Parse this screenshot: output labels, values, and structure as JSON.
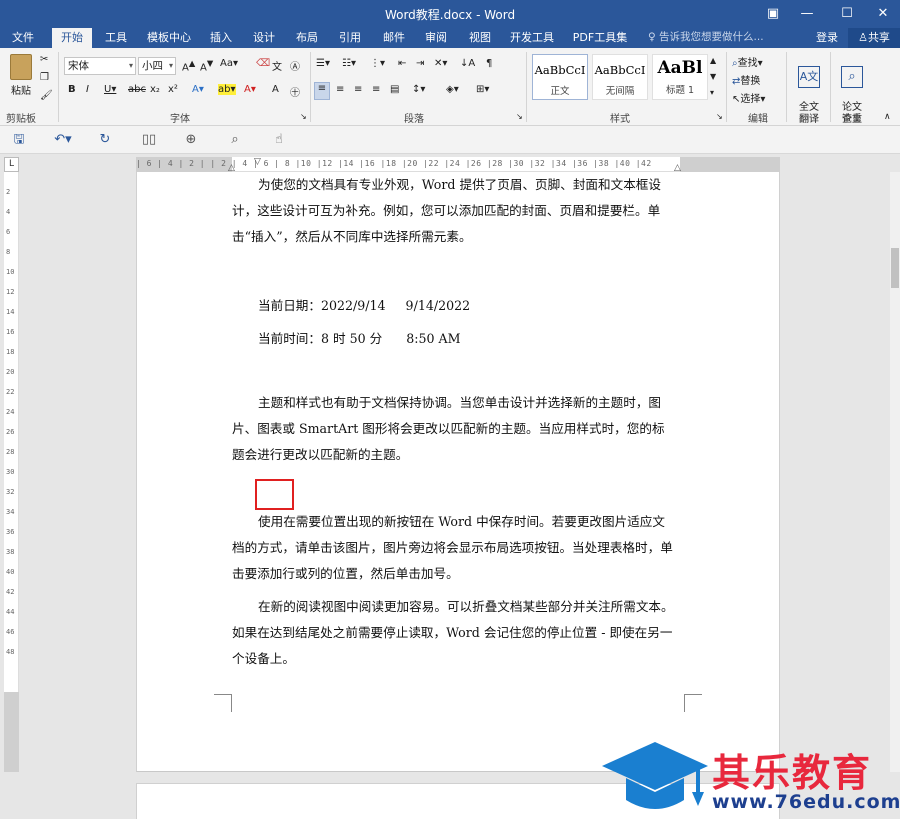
{
  "window": {
    "title": "Word教程.docx - Word",
    "controls": [
      "ribbon-display-icon",
      "minimize-icon",
      "maximize-icon",
      "close-icon"
    ]
  },
  "tabs": [
    "文件",
    "开始",
    "工具",
    "模板中心",
    "插入",
    "设计",
    "布局",
    "引用",
    "邮件",
    "审阅",
    "视图",
    "开发工具",
    "PDF工具集"
  ],
  "active_tab": "开始",
  "tell_me": "告诉我您想要做什么...",
  "account": {
    "login": "登录",
    "share": "共享"
  },
  "ribbon": {
    "clipboard": {
      "paste": "粘贴",
      "label": "剪贴板"
    },
    "font": {
      "name": "宋体",
      "size": "小四",
      "label": "字体"
    },
    "paragraph": {
      "label": "段落"
    },
    "styles": {
      "label": "样式",
      "items": [
        {
          "sample": "AaBbCcI",
          "name": "正文"
        },
        {
          "sample": "AaBbCcI",
          "name": "无间隔"
        },
        {
          "sample": "AaBl",
          "name": "标题 1"
        }
      ]
    },
    "editing": {
      "find": "查找",
      "replace": "替换",
      "select": "选择",
      "label": "编辑"
    },
    "translate": {
      "button": "全文\n翻译",
      "label": "翻译"
    },
    "paper": {
      "button": "论文\n查重",
      "label": "论文"
    }
  },
  "ruler": {
    "h_ticks": "| 6 | 4 | 2 |   | 2 | 4 | 6 | 8 |10 |12 |14 |16 |18 |20 |22 |24 |26 |28 |30 |32 |34 |36 |38 |40 |42",
    "v_ticks": [
      "2",
      "4",
      "6",
      "8",
      "10",
      "12",
      "14",
      "16",
      "18",
      "20",
      "22",
      "24",
      "26",
      "28",
      "30",
      "32",
      "34",
      "36",
      "38",
      "40",
      "42",
      "44",
      "46",
      "48"
    ],
    "corner": "L"
  },
  "document": {
    "para1": "为使您的文档具有专业外观，Word 提供了页眉、页脚、封面和文本框设计，这些设计可互为补充。例如，您可以添加匹配的封面、页眉和提要栏。单击“插入”，然后从不同库中选择所需元素。",
    "date_line": "当前日期：2022/9/14     9/14/2022",
    "time_line": "当前时间：8 时 50 分      8:50 AM",
    "para2": "主题和样式也有助于文档保持协调。当您单击设计并选择新的主题时，图片、图表或 SmartArt 图形将会更改以匹配新的主题。当应用样式时，您的标题会进行更改以匹配新的主题。",
    "para3": "使用在需要位置出现的新按钮在 Word 中保存时间。若要更改图片适应文档的方式，请单击该图片，图片旁边将会显示布局选项按钮。当处理表格时，单击要添加行或列的位置，然后单击加号。",
    "para4": "在新的阅读视图中阅读更加容易。可以折叠文档某些部分并关注所需文本。如果在达到结尾处之前需要停止读取，Word 会记住您的停止位置 - 即使在另一个设备上。"
  },
  "watermark": {
    "brand": "其乐教育",
    "url": "www.76edu.com"
  },
  "colors": {
    "word_blue": "#2b579a",
    "ribbon_bg": "#f3f3f3",
    "highlight_box": "#e02020",
    "brand_red": "#e8283d",
    "brand_blue": "#1d3f8f"
  }
}
